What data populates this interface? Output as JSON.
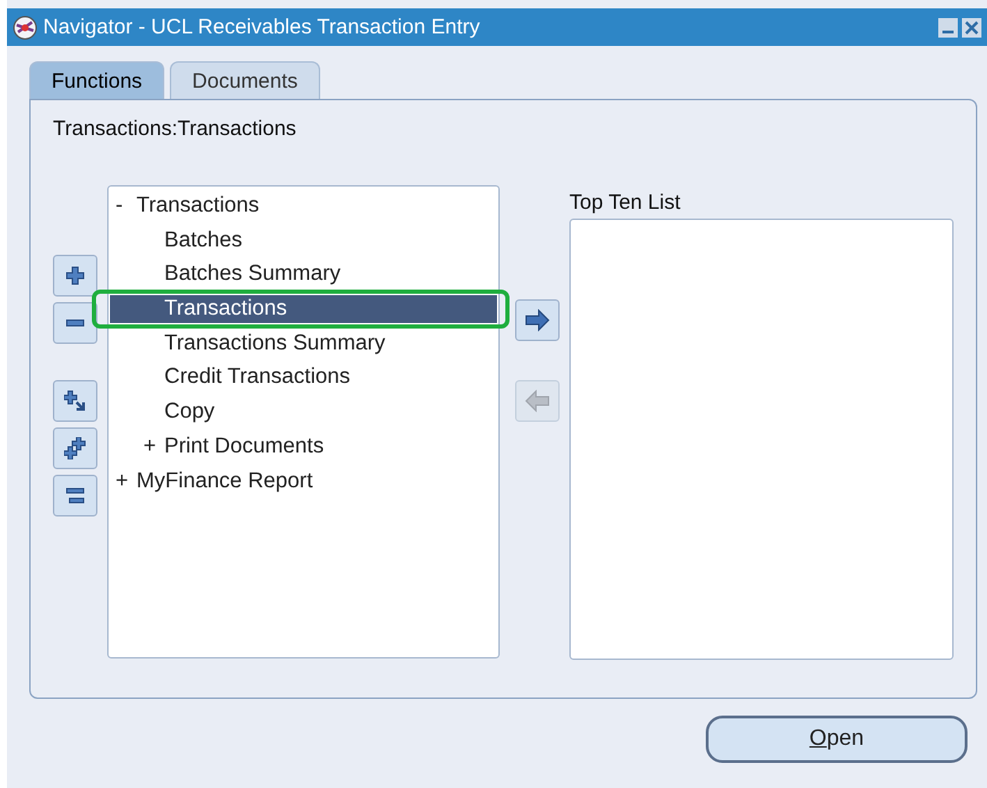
{
  "window": {
    "title": "Navigator - UCL Receivables Transaction Entry"
  },
  "tabs": [
    {
      "label": "Functions",
      "selected": true
    },
    {
      "label": "Documents",
      "selected": false
    }
  ],
  "path": "Transactions:Transactions",
  "tree_tools": [
    {
      "kind": "expand"
    },
    {
      "kind": "collapse"
    },
    {
      "kind": "expand-branch"
    },
    {
      "kind": "expand-all"
    },
    {
      "kind": "collapse-all"
    }
  ],
  "tree": [
    {
      "label": "Transactions",
      "toggle": "-",
      "selected": false,
      "highlighted": false,
      "children": [
        {
          "label": "Batches",
          "selected": false,
          "highlighted": false
        },
        {
          "label": "Batches Summary",
          "selected": false,
          "highlighted": false
        },
        {
          "label": "Transactions",
          "selected": true,
          "highlighted": true
        },
        {
          "label": "Transactions Summary",
          "selected": false,
          "highlighted": false
        },
        {
          "label": "Credit Transactions",
          "selected": false,
          "highlighted": false
        },
        {
          "label": "Copy",
          "selected": false,
          "highlighted": false
        },
        {
          "label": "Print Documents",
          "toggle": "+",
          "selected": false,
          "highlighted": false
        }
      ]
    },
    {
      "label": "MyFinance Report",
      "toggle": "+",
      "selected": false,
      "highlighted": false
    }
  ],
  "move_buttons": [
    {
      "kind": "add",
      "disabled": false
    },
    {
      "kind": "remove",
      "disabled": true
    }
  ],
  "top_ten": {
    "label": "Top Ten List"
  },
  "open_button": {
    "label": "Open"
  }
}
